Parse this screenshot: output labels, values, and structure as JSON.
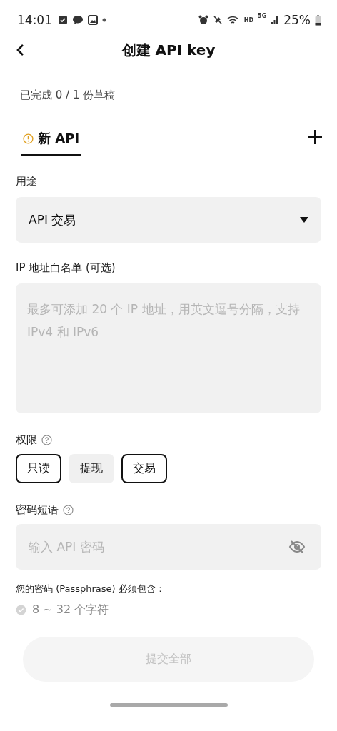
{
  "status_bar": {
    "time": "14:01",
    "network_labels": [
      "HD",
      "5G"
    ],
    "battery": "25%"
  },
  "header": {
    "title": "创建 API key"
  },
  "draft_progress": "已完成 0 / 1 份草稿",
  "tabs": [
    {
      "label": "新 API",
      "selected": true,
      "warning": true
    }
  ],
  "purpose": {
    "label": "用途",
    "value": "API 交易"
  },
  "ip_whitelist": {
    "label": "IP 地址白名单 (可选)",
    "placeholder": "最多可添加 20 个 IP 地址，用英文逗号分隔，支持 IPv4 和 IPv6"
  },
  "permissions": {
    "label": "权限",
    "options": [
      {
        "label": "只读",
        "selected": true
      },
      {
        "label": "提现",
        "selected": false
      },
      {
        "label": "交易",
        "selected": true
      }
    ]
  },
  "passphrase": {
    "label": "密码短语",
    "placeholder": "输入 API 密码",
    "note": "您的密码 (Passphrase) 必须包含：",
    "rules": [
      {
        "text": "8 ~ 32 个字符",
        "met": false
      }
    ]
  },
  "submit": {
    "label": "提交全部",
    "disabled": true
  }
}
